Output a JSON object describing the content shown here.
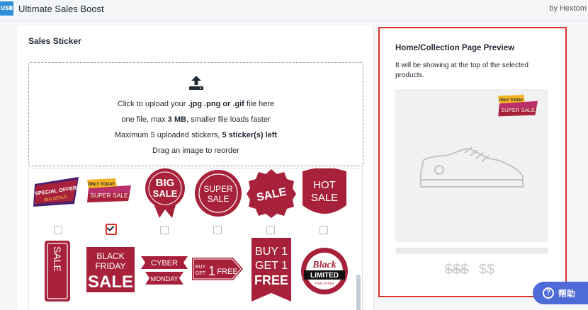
{
  "app": {
    "logo_text": "USB",
    "title": "Ultimate Sales Boost",
    "by": "by Hextom"
  },
  "sales_sticker": {
    "title": "Sales Sticker",
    "upload": {
      "line1_pre": "Click to upload your ",
      "line1_formats": ".jpg .png or .gif",
      "line1_post": " file here",
      "line2_pre": "one file, max ",
      "line2_size": "3 MB",
      "line2_post": ", smaller file loads faster",
      "line3_pre": "Maximum 5 uploaded stickers, ",
      "line3_left": "5 sticker(s) left",
      "line4": "Drag an image to reorder"
    },
    "stickers": [
      {
        "id": "special-offer",
        "text1": "SPECIAL OFFER",
        "text2": "BIG DEALS",
        "checked": false
      },
      {
        "id": "only-today-super-sale",
        "text1": "ONLY TODAY",
        "text2": "SUPER SALE",
        "checked": true
      },
      {
        "id": "big-sale",
        "text1": "BIG",
        "text2": "SALE",
        "checked": false
      },
      {
        "id": "super-sale-round",
        "text1": "SUPER",
        "text2": "SALE",
        "checked": false
      },
      {
        "id": "sale-badge",
        "text1": "SALE",
        "checked": false
      },
      {
        "id": "hot-sale",
        "text1": "HOT",
        "text2": "SALE",
        "checked": false
      },
      {
        "id": "sale-vertical",
        "text1": "SALE"
      },
      {
        "id": "black-friday-sale",
        "text1": "BLACK",
        "text2": "FRIDAY",
        "text3": "SALE"
      },
      {
        "id": "cyber-monday",
        "text1": "CYBER",
        "text2": "MONDAY"
      },
      {
        "id": "buy-1-get-1-free-arrow",
        "text1": "BUY",
        "text2": "GET",
        "text3": "1",
        "text4": "FREE"
      },
      {
        "id": "buy1-get1-free-flag",
        "text1": "BUY 1",
        "text2": "GET 1",
        "text3": "FREE"
      },
      {
        "id": "black-friday-limited",
        "text1": "Black",
        "text2": "LIMITED",
        "text3": "TIME OFFER"
      }
    ]
  },
  "preview": {
    "title": "Home/Collection Page Preview",
    "description": "It will be showing at the top of the selected products.",
    "sticker_text1": "ONLY TODAY",
    "sticker_text2": "SUPER SALE",
    "price_old": "$$$",
    "price_new": "$$"
  },
  "help": {
    "label": "帮助",
    "icon": "?"
  },
  "colors": {
    "sticker_red": "#a8213a",
    "accent_red": "#d8332a",
    "help_blue": "#4d6ad6",
    "logo_blue": "#2f8fd8"
  }
}
